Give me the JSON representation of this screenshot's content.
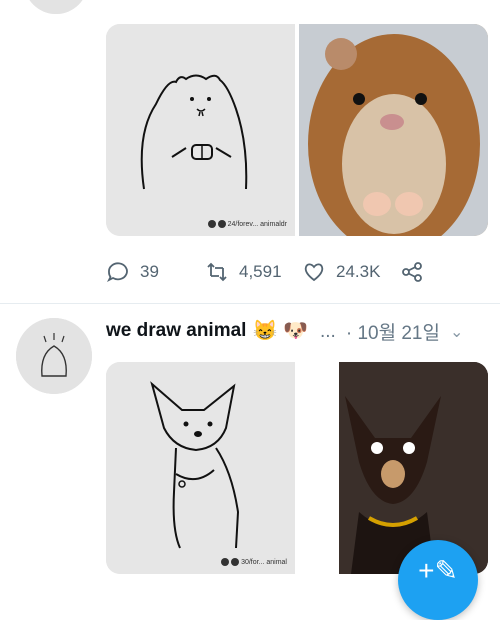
{
  "tweet1": {
    "media": [
      {
        "kind": "sketch",
        "watermark": "24/forev... animaldr"
      },
      {
        "kind": "photo",
        "alt_icon": "hamster-photo"
      }
    ],
    "actions": {
      "replies": "39",
      "retweets": "4,591",
      "likes": "24.3K"
    }
  },
  "tweet2": {
    "name": "we draw animal",
    "name_emojis": [
      "😸",
      "🐶"
    ],
    "ellipsis": "...",
    "date": "· 10월 21일",
    "media": [
      {
        "kind": "sketch",
        "watermark": "30/for... animal"
      },
      {
        "kind": "photo",
        "alt_icon": "chihuahua-photo"
      }
    ]
  },
  "colors": {
    "accent": "#1da1f2",
    "muted": "#657786",
    "divider": "#e6ecf0"
  }
}
